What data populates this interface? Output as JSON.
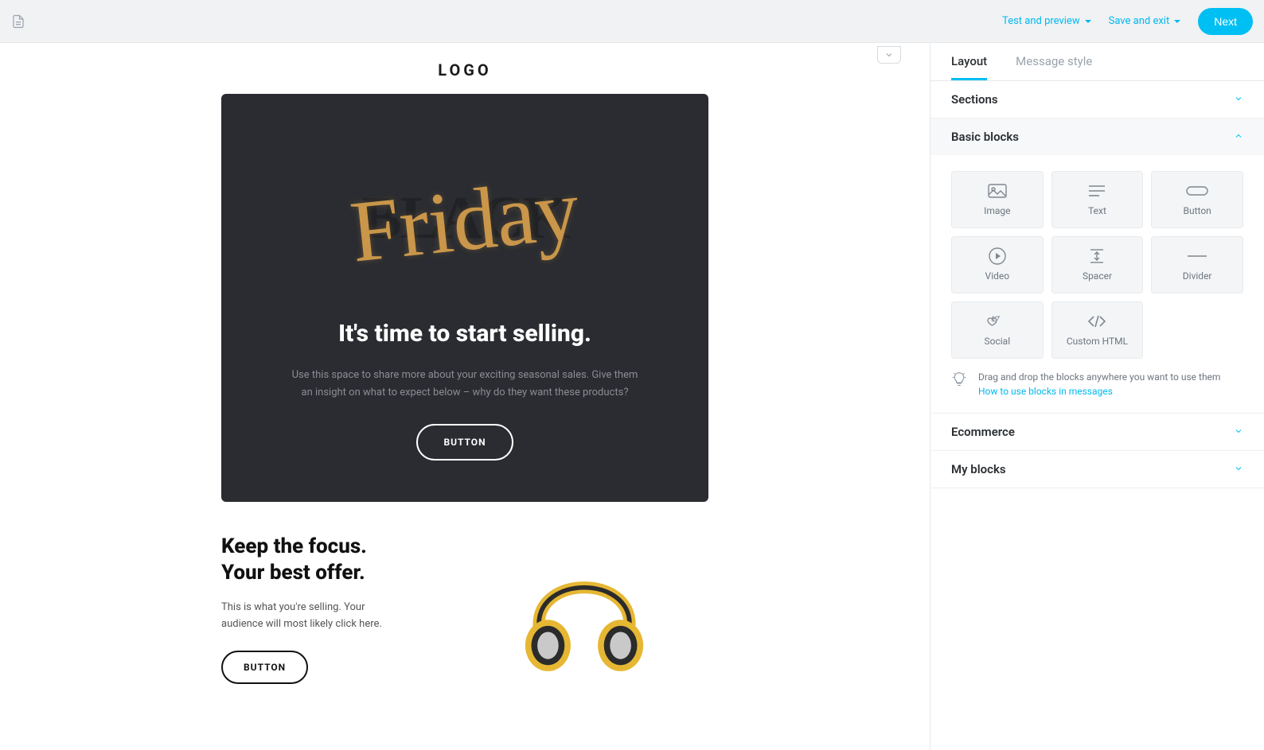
{
  "topbar": {
    "test_preview": "Test and preview",
    "save_exit": "Save and exit",
    "next": "Next"
  },
  "preview": {
    "logo": "LOGO",
    "hero": {
      "black": "BLACK",
      "friday": "Friday",
      "heading": "It's time to start selling.",
      "subtext": "Use this space to share more about your exciting seasonal sales. Give them an insight on what to expect below – why do they want these products?",
      "button": "BUTTON"
    },
    "section2": {
      "title1": "Keep the focus.",
      "title2": "Your best offer.",
      "text": "This is what you're selling. Your audience will most likely click here.",
      "button": "BUTTON"
    }
  },
  "sidebar": {
    "tabs": {
      "layout": "Layout",
      "message_style": "Message style"
    },
    "sections_label": "Sections",
    "basic_blocks_label": "Basic blocks",
    "ecommerce_label": "Ecommerce",
    "my_blocks_label": "My blocks",
    "blocks": {
      "image": "Image",
      "text": "Text",
      "button": "Button",
      "video": "Video",
      "spacer": "Spacer",
      "divider": "Divider",
      "social": "Social",
      "custom_html": "Custom HTML"
    },
    "hint_text": "Drag and drop the blocks anywhere you want to use them",
    "hint_link": "How to use blocks in messages"
  }
}
